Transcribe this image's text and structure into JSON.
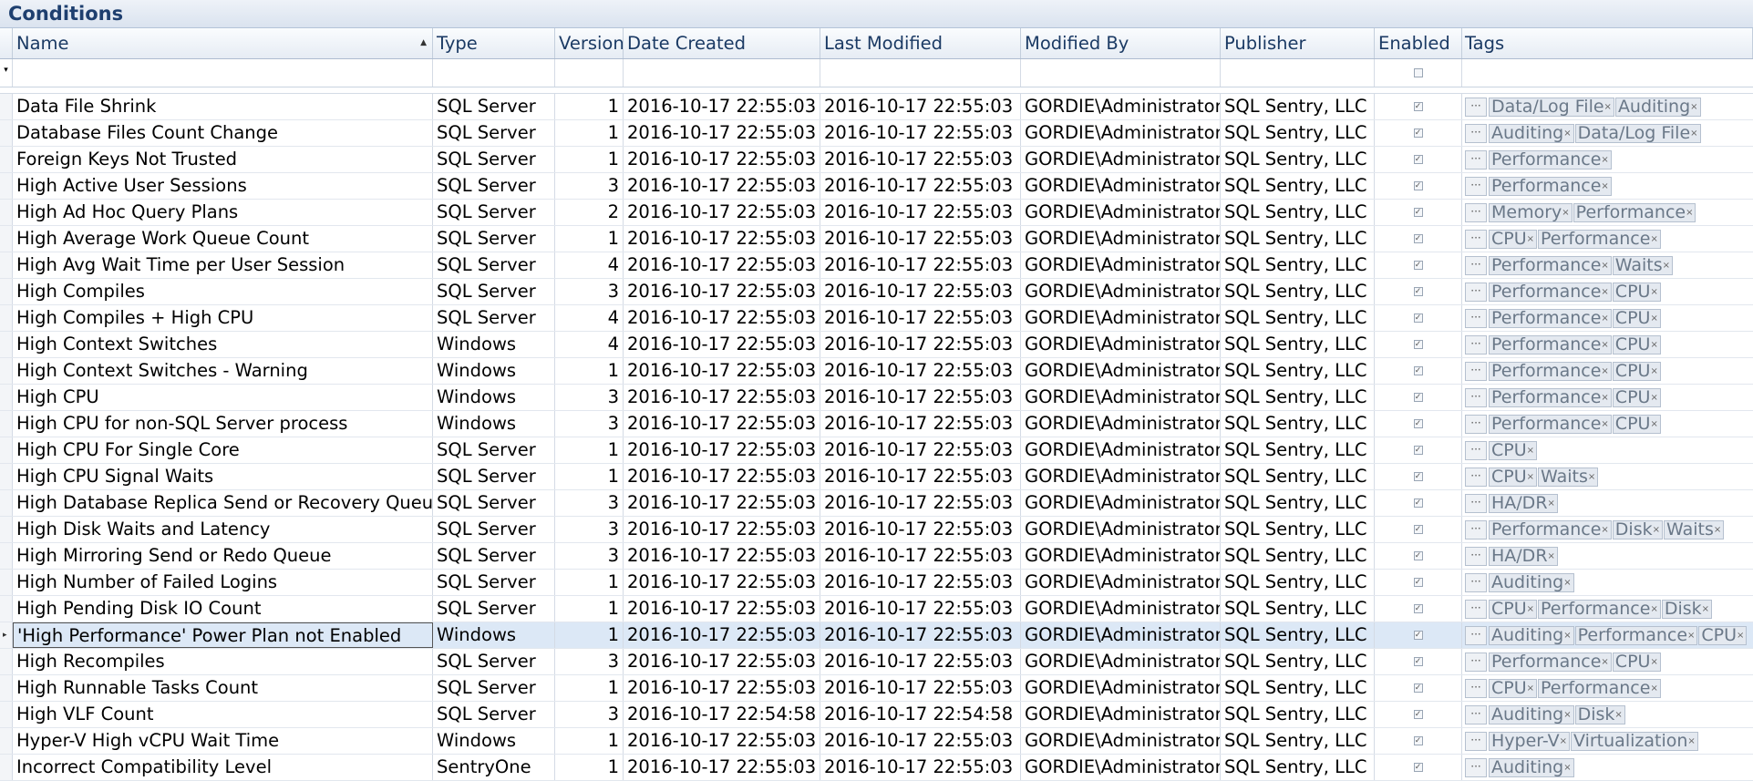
{
  "title": "Conditions",
  "columns": [
    "Name",
    "Type",
    "Version",
    "Date Created",
    "Last Modified",
    "Modified By",
    "Publisher",
    "Enabled",
    "Tags"
  ],
  "rows": [
    {
      "name": "Data File Shrink",
      "type": "SQL Server",
      "version": "1",
      "created": "2016-10-17 22:55:03",
      "modified": "2016-10-17 22:55:03",
      "by": "GORDIE\\Administrator",
      "publisher": "SQL Sentry, LLC",
      "tags": [
        "Data/Log File",
        "Auditing"
      ]
    },
    {
      "name": "Database Files Count Change",
      "type": "SQL Server",
      "version": "1",
      "created": "2016-10-17 22:55:03",
      "modified": "2016-10-17 22:55:03",
      "by": "GORDIE\\Administrator",
      "publisher": "SQL Sentry, LLC",
      "tags": [
        "Auditing",
        "Data/Log File"
      ]
    },
    {
      "name": "Foreign Keys Not Trusted",
      "type": "SQL Server",
      "version": "1",
      "created": "2016-10-17 22:55:03",
      "modified": "2016-10-17 22:55:03",
      "by": "GORDIE\\Administrator",
      "publisher": "SQL Sentry, LLC",
      "tags": [
        "Performance"
      ]
    },
    {
      "name": "High Active User Sessions",
      "type": "SQL Server",
      "version": "3",
      "created": "2016-10-17 22:55:03",
      "modified": "2016-10-17 22:55:03",
      "by": "GORDIE\\Administrator",
      "publisher": "SQL Sentry, LLC",
      "tags": [
        "Performance"
      ]
    },
    {
      "name": "High Ad Hoc Query Plans",
      "type": "SQL Server",
      "version": "2",
      "created": "2016-10-17 22:55:03",
      "modified": "2016-10-17 22:55:03",
      "by": "GORDIE\\Administrator",
      "publisher": "SQL Sentry, LLC",
      "tags": [
        "Memory",
        "Performance"
      ]
    },
    {
      "name": "High Average Work Queue Count",
      "type": "SQL Server",
      "version": "1",
      "created": "2016-10-17 22:55:03",
      "modified": "2016-10-17 22:55:03",
      "by": "GORDIE\\Administrator",
      "publisher": "SQL Sentry, LLC",
      "tags": [
        "CPU",
        "Performance"
      ]
    },
    {
      "name": "High Avg Wait Time per User Session",
      "type": "SQL Server",
      "version": "4",
      "created": "2016-10-17 22:55:03",
      "modified": "2016-10-17 22:55:03",
      "by": "GORDIE\\Administrator",
      "publisher": "SQL Sentry, LLC",
      "tags": [
        "Performance",
        "Waits"
      ]
    },
    {
      "name": "High Compiles",
      "type": "SQL Server",
      "version": "3",
      "created": "2016-10-17 22:55:03",
      "modified": "2016-10-17 22:55:03",
      "by": "GORDIE\\Administrator",
      "publisher": "SQL Sentry, LLC",
      "tags": [
        "Performance",
        "CPU"
      ]
    },
    {
      "name": "High Compiles + High CPU",
      "type": "SQL Server",
      "version": "4",
      "created": "2016-10-17 22:55:03",
      "modified": "2016-10-17 22:55:03",
      "by": "GORDIE\\Administrator",
      "publisher": "SQL Sentry, LLC",
      "tags": [
        "Performance",
        "CPU"
      ]
    },
    {
      "name": "High Context Switches",
      "type": "Windows",
      "version": "4",
      "created": "2016-10-17 22:55:03",
      "modified": "2016-10-17 22:55:03",
      "by": "GORDIE\\Administrator",
      "publisher": "SQL Sentry, LLC",
      "tags": [
        "Performance",
        "CPU"
      ]
    },
    {
      "name": "High Context Switches - Warning",
      "type": "Windows",
      "version": "1",
      "created": "2016-10-17 22:55:03",
      "modified": "2016-10-17 22:55:03",
      "by": "GORDIE\\Administrator",
      "publisher": "SQL Sentry, LLC",
      "tags": [
        "Performance",
        "CPU"
      ]
    },
    {
      "name": "High CPU",
      "type": "Windows",
      "version": "3",
      "created": "2016-10-17 22:55:03",
      "modified": "2016-10-17 22:55:03",
      "by": "GORDIE\\Administrator",
      "publisher": "SQL Sentry, LLC",
      "tags": [
        "Performance",
        "CPU"
      ]
    },
    {
      "name": "High CPU for non-SQL Server process",
      "type": "Windows",
      "version": "3",
      "created": "2016-10-17 22:55:03",
      "modified": "2016-10-17 22:55:03",
      "by": "GORDIE\\Administrator",
      "publisher": "SQL Sentry, LLC",
      "tags": [
        "Performance",
        "CPU"
      ]
    },
    {
      "name": "High CPU For Single Core",
      "type": "SQL Server",
      "version": "1",
      "created": "2016-10-17 22:55:03",
      "modified": "2016-10-17 22:55:03",
      "by": "GORDIE\\Administrator",
      "publisher": "SQL Sentry, LLC",
      "tags": [
        "CPU"
      ]
    },
    {
      "name": "High CPU Signal Waits",
      "type": "SQL Server",
      "version": "1",
      "created": "2016-10-17 22:55:03",
      "modified": "2016-10-17 22:55:03",
      "by": "GORDIE\\Administrator",
      "publisher": "SQL Sentry, LLC",
      "tags": [
        "CPU",
        "Waits"
      ]
    },
    {
      "name": "High Database Replica Send or Recovery Queue",
      "type": "SQL Server",
      "version": "3",
      "created": "2016-10-17 22:55:03",
      "modified": "2016-10-17 22:55:03",
      "by": "GORDIE\\Administrator",
      "publisher": "SQL Sentry, LLC",
      "tags": [
        "HA/DR"
      ]
    },
    {
      "name": "High Disk Waits and Latency",
      "type": "SQL Server",
      "version": "3",
      "created": "2016-10-17 22:55:03",
      "modified": "2016-10-17 22:55:03",
      "by": "GORDIE\\Administrator",
      "publisher": "SQL Sentry, LLC",
      "tags": [
        "Performance",
        "Disk",
        "Waits"
      ]
    },
    {
      "name": "High Mirroring Send or Redo Queue",
      "type": "SQL Server",
      "version": "3",
      "created": "2016-10-17 22:55:03",
      "modified": "2016-10-17 22:55:03",
      "by": "GORDIE\\Administrator",
      "publisher": "SQL Sentry, LLC",
      "tags": [
        "HA/DR"
      ]
    },
    {
      "name": "High Number of Failed Logins",
      "type": "SQL Server",
      "version": "1",
      "created": "2016-10-17 22:55:03",
      "modified": "2016-10-17 22:55:03",
      "by": "GORDIE\\Administrator",
      "publisher": "SQL Sentry, LLC",
      "tags": [
        "Auditing"
      ]
    },
    {
      "name": "High Pending Disk IO Count",
      "type": "SQL Server",
      "version": "1",
      "created": "2016-10-17 22:55:03",
      "modified": "2016-10-17 22:55:03",
      "by": "GORDIE\\Administrator",
      "publisher": "SQL Sentry, LLC",
      "tags": [
        "CPU",
        "Performance",
        "Disk"
      ]
    },
    {
      "name": "'High Performance' Power Plan not Enabled",
      "type": "Windows",
      "version": "1",
      "created": "2016-10-17 22:55:03",
      "modified": "2016-10-17 22:55:03",
      "by": "GORDIE\\Administrator",
      "publisher": "SQL Sentry, LLC",
      "tags": [
        "Auditing",
        "Performance",
        "CPU"
      ],
      "selected": true
    },
    {
      "name": "High Recompiles",
      "type": "SQL Server",
      "version": "3",
      "created": "2016-10-17 22:55:03",
      "modified": "2016-10-17 22:55:03",
      "by": "GORDIE\\Administrator",
      "publisher": "SQL Sentry, LLC",
      "tags": [
        "Performance",
        "CPU"
      ]
    },
    {
      "name": "High Runnable Tasks Count",
      "type": "SQL Server",
      "version": "1",
      "created": "2016-10-17 22:55:03",
      "modified": "2016-10-17 22:55:03",
      "by": "GORDIE\\Administrator",
      "publisher": "SQL Sentry, LLC",
      "tags": [
        "CPU",
        "Performance"
      ]
    },
    {
      "name": "High VLF Count",
      "type": "SQL Server",
      "version": "3",
      "created": "2016-10-17 22:54:58",
      "modified": "2016-10-17 22:54:58",
      "by": "GORDIE\\Administrator",
      "publisher": "SQL Sentry, LLC",
      "tags": [
        "Auditing",
        "Disk"
      ]
    },
    {
      "name": "Hyper-V High vCPU Wait Time",
      "type": "Windows",
      "version": "1",
      "created": "2016-10-17 22:55:03",
      "modified": "2016-10-17 22:55:03",
      "by": "GORDIE\\Administrator",
      "publisher": "SQL Sentry, LLC",
      "tags": [
        "Hyper-V",
        "Virtualization"
      ]
    },
    {
      "name": "Incorrect Compatibility Level",
      "type": "SentryOne",
      "version": "1",
      "created": "2016-10-17 22:55:03",
      "modified": "2016-10-17 22:55:03",
      "by": "GORDIE\\Administrator",
      "publisher": "SQL Sentry, LLC",
      "tags": [
        "Auditing"
      ]
    }
  ],
  "icons": {
    "sort": "sort-ascending-icon",
    "filter": "filter-row-icon",
    "ellipsis": "ellipsis-icon",
    "tag_remove": "tag-remove-icon",
    "row_indicator": "row-indicator-icon"
  },
  "colors": {
    "title_text": "#1e3f6f",
    "header_text": "#1b3a64",
    "selected_row": "#dce8f6"
  }
}
